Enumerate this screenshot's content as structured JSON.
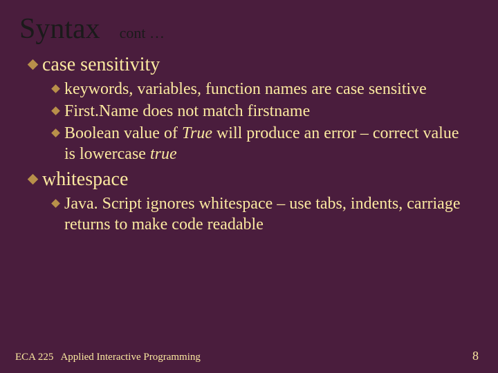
{
  "header": {
    "title": "Syntax",
    "cont": "cont …"
  },
  "bullets": {
    "b1": {
      "label": "case sensitivity",
      "sub1a": "keywords, variables, function names are case sensitive",
      "sub1b": "First.Name does not match firstname",
      "sub1c_pre": "Boolean value of ",
      "sub1c_true1": "True",
      "sub1c_mid": " will produce an error – correct value is lowercase ",
      "sub1c_true2": "true"
    },
    "b2": {
      "label": "whitespace",
      "sub2a": "Java. Script ignores whitespace – use tabs, indents, carriage returns to make code readable"
    }
  },
  "footer": {
    "course": "ECA 225",
    "title": "Applied Interactive Programming",
    "page": "8"
  }
}
